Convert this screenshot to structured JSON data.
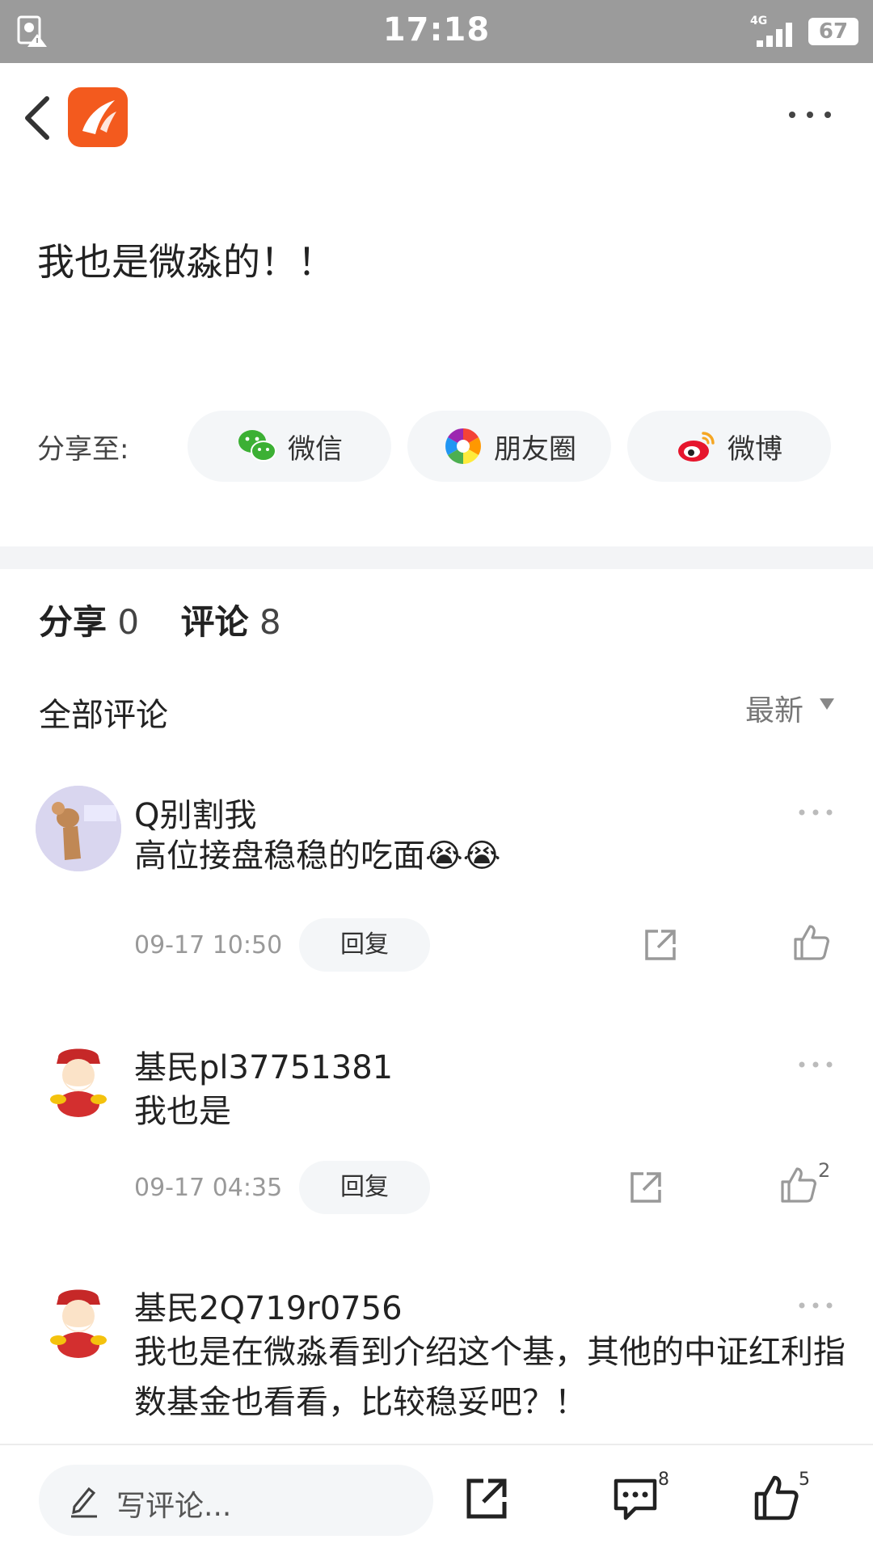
{
  "status_bar": {
    "time": "17:18",
    "network": "4G",
    "battery": "67"
  },
  "post": {
    "text": "我也是微淼的！！"
  },
  "share": {
    "label": "分享至:",
    "targets": [
      {
        "label": "微信",
        "icon": "wechat-icon"
      },
      {
        "label": "朋友圈",
        "icon": "moments-icon"
      },
      {
        "label": "微博",
        "icon": "weibo-icon"
      }
    ]
  },
  "stats": {
    "share_label": "分享",
    "share_count": "0",
    "comment_label": "评论",
    "comment_count": "8"
  },
  "comments_header": {
    "title": "全部评论",
    "sort": "最新"
  },
  "comments": [
    {
      "name": "Q别割我",
      "text": "高位接盘稳稳的吃面😭😭",
      "time": "09-17 10:50",
      "reply": "回复",
      "likes": ""
    },
    {
      "name": "基民pl37751381",
      "text": "我也是",
      "time": "09-17 04:35",
      "reply": "回复",
      "likes": "2"
    },
    {
      "name": "基民2Q719r0756",
      "text": "我也是在微淼看到介绍这个基，其他的中证红利指数基金也看看，比较稳妥吧？！",
      "time": "",
      "reply": "",
      "likes": ""
    }
  ],
  "bottom_bar": {
    "placeholder": "写评论...",
    "comment_count": "8",
    "like_count": "5"
  },
  "colors": {
    "brand": "#f35a1e",
    "status_bar": "#9b9b9b",
    "chip_bg": "#f4f6f8"
  }
}
